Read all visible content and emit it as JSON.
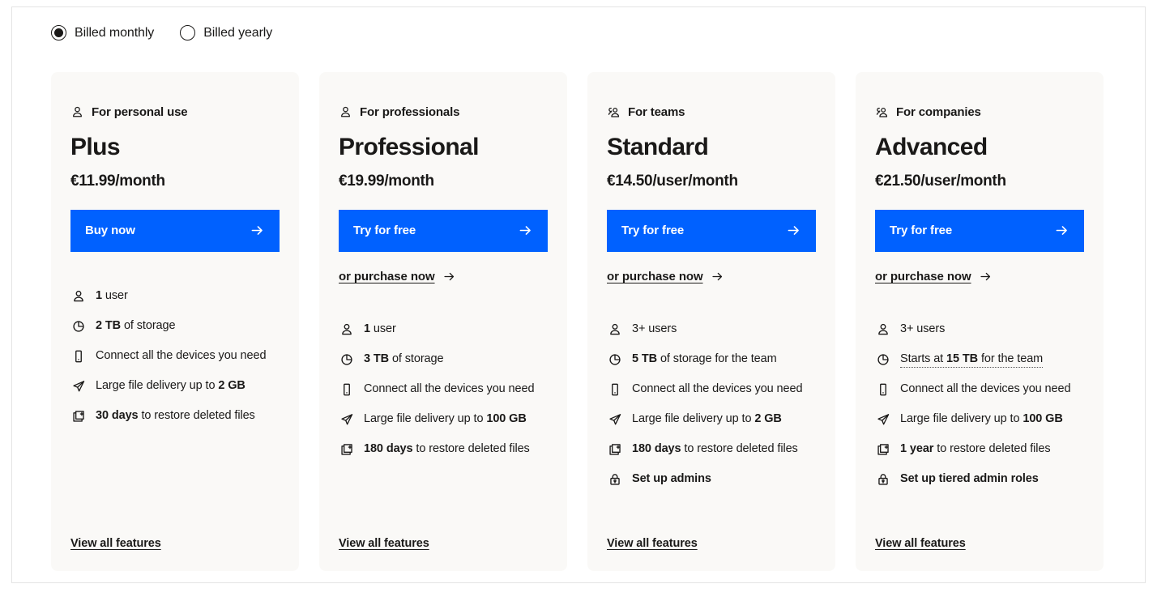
{
  "billing": {
    "options": [
      {
        "label": "Billed monthly",
        "selected": true
      },
      {
        "label": "Billed yearly",
        "selected": false
      }
    ]
  },
  "plans": [
    {
      "audience": "For personal use",
      "audience_icon": "person-icon",
      "name": "Plus",
      "price": "€11.99/month",
      "cta_label": "Buy now",
      "secondary_label": null,
      "view_all_label": "View all features",
      "features": [
        {
          "icon": "person-icon",
          "bold": "1",
          "rest": " user",
          "style": "normal"
        },
        {
          "icon": "storage-icon",
          "bold": "2 TB",
          "rest": " of storage",
          "style": "normal"
        },
        {
          "icon": "device-icon",
          "bold": "",
          "rest": "Connect all the devices you need",
          "style": "normal"
        },
        {
          "icon": "send-icon",
          "bold": "",
          "rest": "Large file delivery up to ",
          "tail": "2 GB",
          "style": "tail-bold"
        },
        {
          "icon": "restore-icon",
          "bold": "30 days",
          "rest": " to restore deleted files",
          "style": "normal"
        }
      ]
    },
    {
      "audience": "For professionals",
      "audience_icon": "person-icon",
      "name": "Professional",
      "price": "€19.99/month",
      "cta_label": "Try for free",
      "secondary_label": "or purchase now",
      "view_all_label": "View all features",
      "features": [
        {
          "icon": "person-icon",
          "bold": "1",
          "rest": " user",
          "style": "normal"
        },
        {
          "icon": "storage-icon",
          "bold": "3 TB",
          "rest": " of storage",
          "style": "normal"
        },
        {
          "icon": "device-icon",
          "bold": "",
          "rest": "Connect all the devices you need",
          "style": "normal"
        },
        {
          "icon": "send-icon",
          "bold": "",
          "rest": "Large file delivery up to ",
          "tail": "100 GB",
          "style": "tail-bold"
        },
        {
          "icon": "restore-icon",
          "bold": "180 days",
          "rest": " to restore deleted files",
          "style": "normal"
        }
      ]
    },
    {
      "audience": "For teams",
      "audience_icon": "group-icon",
      "name": "Standard",
      "price": "€14.50/user/month",
      "cta_label": "Try for free",
      "secondary_label": "or purchase now",
      "view_all_label": "View all features",
      "features": [
        {
          "icon": "person-icon",
          "bold": "",
          "rest": "3+ users",
          "style": "normal"
        },
        {
          "icon": "storage-icon",
          "bold": "5 TB",
          "rest": " of storage for the team",
          "style": "normal"
        },
        {
          "icon": "device-icon",
          "bold": "",
          "rest": "Connect all the devices you need",
          "style": "normal"
        },
        {
          "icon": "send-icon",
          "bold": "",
          "rest": "Large file delivery up to ",
          "tail": "2 GB",
          "style": "tail-bold"
        },
        {
          "icon": "restore-icon",
          "bold": "180 days",
          "rest": " to restore deleted files",
          "style": "normal"
        },
        {
          "icon": "lock-icon",
          "bold": "",
          "rest": "Set up admins",
          "style": "all-bold"
        }
      ]
    },
    {
      "audience": "For companies",
      "audience_icon": "group-icon",
      "name": "Advanced",
      "price": "€21.50/user/month",
      "cta_label": "Try for free",
      "secondary_label": "or purchase now",
      "view_all_label": "View all features",
      "features": [
        {
          "icon": "person-icon",
          "bold": "",
          "rest": "3+ users",
          "style": "normal"
        },
        {
          "icon": "storage-icon",
          "bold": "",
          "rest": "Starts at ",
          "mid": "15 TB",
          "tail2": " for the team",
          "style": "tooltip"
        },
        {
          "icon": "device-icon",
          "bold": "",
          "rest": "Connect all the devices you need",
          "style": "normal"
        },
        {
          "icon": "send-icon",
          "bold": "",
          "rest": "Large file delivery up to ",
          "tail": "100 GB",
          "style": "tail-bold"
        },
        {
          "icon": "restore-icon",
          "bold": "1 year",
          "rest": " to restore deleted files",
          "style": "normal"
        },
        {
          "icon": "lock-icon",
          "bold": "",
          "rest": "Set up tiered admin roles",
          "style": "all-bold"
        }
      ]
    }
  ],
  "colors": {
    "cta_blue": "#0061ff",
    "card_bg": "#faf9f7",
    "text": "#1a1918"
  }
}
